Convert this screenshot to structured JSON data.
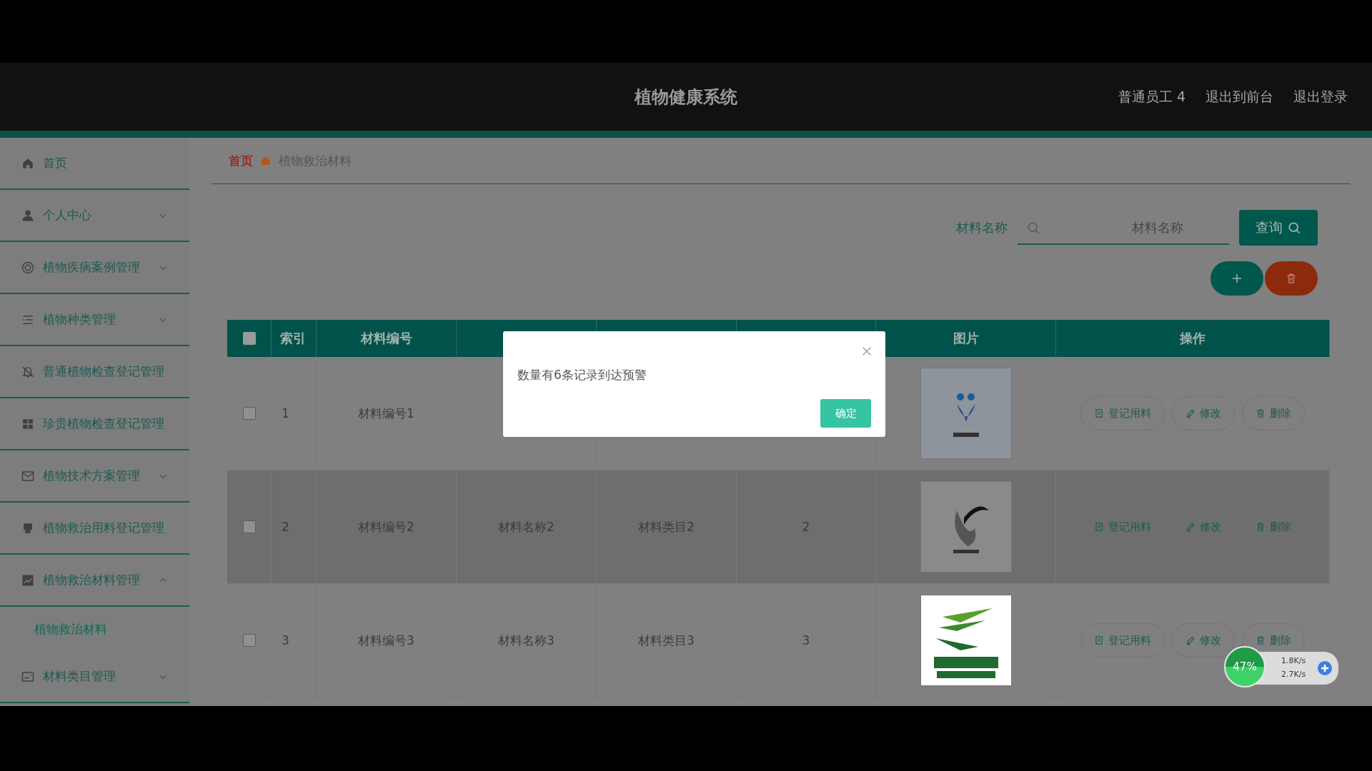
{
  "header": {
    "title": "植物健康系统",
    "links": [
      "普通员工 4",
      "退出到前台",
      "退出登录"
    ]
  },
  "sidebar": {
    "items": [
      {
        "label": "首页"
      },
      {
        "label": "个人中心",
        "expanded": false
      },
      {
        "label": "植物疾病案例管理",
        "expanded": false
      },
      {
        "label": "植物种类管理",
        "expanded": false
      },
      {
        "label": "普通植物检查登记管理"
      },
      {
        "label": "珍贵植物检查登记管理"
      },
      {
        "label": "植物技术方案管理",
        "expanded": false
      },
      {
        "label": "植物救治用料登记管理"
      },
      {
        "label": "植物救治材料管理",
        "expanded": true,
        "children": [
          {
            "label": "植物救治材料",
            "selected": true
          }
        ]
      },
      {
        "label": "材料类目管理",
        "expanded": false
      }
    ]
  },
  "breadcrumb": [
    "首页",
    "植物救治材料"
  ],
  "search": {
    "label": "材料名称",
    "placeholder": "材料名称",
    "button": "查询"
  },
  "table": {
    "columns": [
      {
        "kind": "checkbox",
        "checked": false
      },
      {
        "kind": "text",
        "label": "索引"
      },
      {
        "kind": "text",
        "label": "材料编号"
      },
      {
        "kind": "covered"
      },
      {
        "kind": "covered"
      },
      {
        "kind": "covered"
      },
      {
        "kind": "text",
        "label": "图片"
      },
      {
        "kind": "text",
        "label": "操作"
      }
    ],
    "rows": [
      {
        "checked": false,
        "hovered": false,
        "index": "1",
        "code": "材料编号1",
        "actions": [
          "登记用料",
          "修改",
          "删除"
        ]
      },
      {
        "checked": false,
        "hovered": true,
        "index": "2",
        "code": "材料编号2",
        "name": "材料名称2",
        "category": "材料类目2",
        "quantity": "2",
        "actions": [
          "登记用料",
          "修改",
          "删除"
        ]
      },
      {
        "checked": false,
        "hovered": false,
        "index": "3",
        "code": "材料编号3",
        "name": "材料名称3",
        "category": "材料类目3",
        "quantity": "3",
        "actions": [
          "登记用料",
          "修改",
          "删除"
        ]
      }
    ]
  },
  "dialog": {
    "message": "数量有6条记录到达预警",
    "button": "确定"
  },
  "speed_widget": {
    "percent": "47%",
    "upload": "1.8K/s",
    "download": "2.7K/s"
  }
}
